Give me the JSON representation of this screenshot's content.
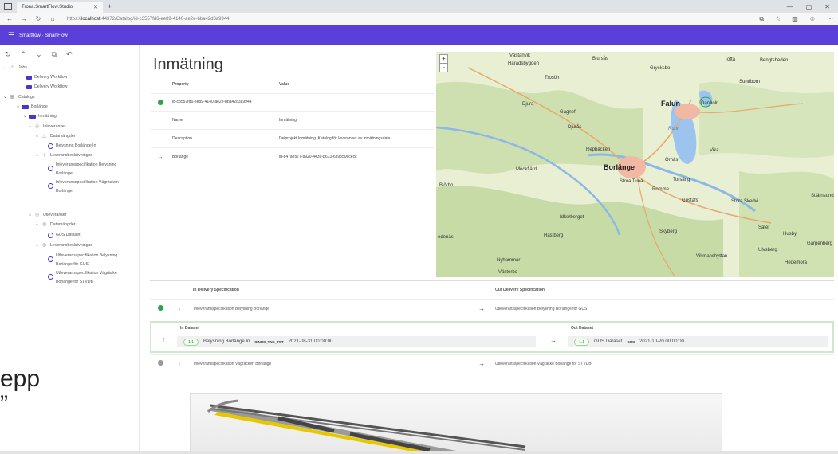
{
  "browser": {
    "tab_title": "Trona.SmartFlow.Studio",
    "url_prefix": "https://",
    "url_host": "localhost",
    "url_rest": ":44372/Catalog/id-c3557fd6-ee89-4140-ae2e-bba42d3a9944"
  },
  "app": {
    "title": "Smartflow · SmartFlow"
  },
  "tree": [
    {
      "label": "Jobs"
    },
    {
      "label": "Delivery Workflow"
    },
    {
      "label": "Delivery Workflow"
    },
    {
      "label": "Catalogs"
    },
    {
      "label": "Borlänge"
    },
    {
      "label": "Inmätning"
    },
    {
      "label": "Inleveranser"
    },
    {
      "label": "Datamängder"
    },
    {
      "label": "Belysning Borlänge In"
    },
    {
      "label": "Leveransbeskrivningar"
    },
    {
      "label": "Inleveransspecifikation Belysning",
      "label2": "Borlänge"
    },
    {
      "label": "Inleveransspecifikation Vägräcken",
      "label2": "Borlänge"
    },
    {
      "label": "Utleveranser"
    },
    {
      "label": "Datamängder"
    },
    {
      "label": "GUS Dataset"
    },
    {
      "label": "Leveransbeskrivningar"
    },
    {
      "label": "Utleveransspecifikation Belysning",
      "label2": "Borlänge för GUS"
    },
    {
      "label": "Utleveransspecifikation Vägräcke",
      "label2": "Borlänge för STVDB"
    }
  ],
  "overlay_text": {
    "line1": "epp",
    "line2": "”"
  },
  "main": {
    "title": "Inmätning",
    "columns": {
      "property": "Property",
      "value": "Value"
    },
    "rows": [
      {
        "property": "id-c3557fd6-ee89-4140-ae2e-bba42d3a9944",
        "value": ""
      },
      {
        "property": "Name",
        "value": "Inmätning"
      },
      {
        "property": "Description",
        "value": "Delprojekt Inmätning. Katalog för leveranser av inmätningsdata."
      },
      {
        "property": "Borlänge",
        "value": "id-847ae577-8920-4439-b673-6393506cecc"
      }
    ]
  },
  "map": {
    "zoom_in": "+",
    "zoom_out": "-",
    "labels": [
      {
        "text": "Västanvik",
        "cls": ""
      },
      {
        "text": "Häradsbygden",
        "cls": ""
      },
      {
        "text": "Trosön",
        "cls": ""
      },
      {
        "text": "Bjursås",
        "cls": ""
      },
      {
        "text": "Bengtsheden",
        "cls": ""
      },
      {
        "text": "Grycksbo",
        "cls": ""
      },
      {
        "text": "Tofta",
        "cls": ""
      },
      {
        "text": "Sundborn",
        "cls": ""
      },
      {
        "text": "Djura",
        "cls": ""
      },
      {
        "text": "Gagnef",
        "cls": ""
      },
      {
        "text": "Falun",
        "cls": "big"
      },
      {
        "text": "Danholn",
        "cls": ""
      },
      {
        "text": "Djurås",
        "cls": ""
      },
      {
        "text": "Runn",
        "cls": "water"
      },
      {
        "text": "Repbäcken",
        "cls": ""
      },
      {
        "text": "Vika",
        "cls": ""
      },
      {
        "text": "Mockfjärd",
        "cls": ""
      },
      {
        "text": "Borlänge",
        "cls": "big"
      },
      {
        "text": "Ornäs",
        "cls": ""
      },
      {
        "text": "Stora Tuna",
        "cls": ""
      },
      {
        "text": "Torsång",
        "cls": ""
      },
      {
        "text": "Björbo",
        "cls": ""
      },
      {
        "text": "Gustafs",
        "cls": ""
      },
      {
        "text": "Stora Skedvi",
        "cls": ""
      },
      {
        "text": "Stjärnsund",
        "cls": ""
      },
      {
        "text": "Idkerberget",
        "cls": ""
      },
      {
        "text": "Husby",
        "cls": ""
      },
      {
        "text": "Säter",
        "cls": ""
      },
      {
        "text": "Hästberg",
        "cls": ""
      },
      {
        "text": "Skyberg",
        "cls": ""
      },
      {
        "text": "Garpenberg",
        "cls": ""
      },
      {
        "text": "edenäs",
        "cls": ""
      },
      {
        "text": "Nyhammar",
        "cls": ""
      },
      {
        "text": "Vikmanshyttan",
        "cls": ""
      },
      {
        "text": "Hedemora",
        "cls": ""
      },
      {
        "text": "Västerbo",
        "cls": ""
      },
      {
        "text": "Rommе",
        "cls": ""
      },
      {
        "text": "Ulvsberg",
        "cls": ""
      }
    ]
  },
  "delivery": {
    "in_header": "In Delivery Specification",
    "out_header": "Out Delivery Specification",
    "rows": [
      {
        "in": "Inleveransspecifikation Belysning Borlänge",
        "out": "Utleveransspecifikation Belysning Borlänge för GUS"
      },
      {
        "in": "Inleveransspecifikation Vägräcken Borlänge",
        "out": "Utleveransspecifikation Vägräcke Borlänge för STVDB"
      }
    ],
    "expanded": {
      "in_label": "In Dataset",
      "out_label": "Out Dataset",
      "in_chip": "1.1",
      "in_name": "Belysning Borlänge In",
      "in_code": "SINUS_TNE_TST",
      "in_date": "2021-08-31 00:00:00",
      "out_chip": "1.1",
      "out_name": "GUS Dataset",
      "out_code": "GUS",
      "out_date": "2021-10-20 00:00:00"
    }
  }
}
